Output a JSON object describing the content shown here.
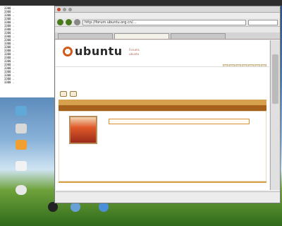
{
  "desktop": {
    "topbar": {
      "title": "",
      "clock": ""
    },
    "terminal_lines": [
      "  3300 .  ",
      "  3300 .  ",
      "  3300 .  ",
      "  3300 .  ",
      "  3300 .  ",
      "  3300 .  ",
      "  3300 .  ",
      "  3300 .  ",
      "  3300 .  ",
      "  3300 .  ",
      "  3300 .  ",
      "  3300 .  ",
      "  3300 .  ",
      "  3300 .  ",
      "  3300 .  ",
      "  3300 .  ",
      "  3300 .  ",
      "  3300 .  ",
      "  3300 .  ",
      "  3300 .  ",
      "  3300 .  ",
      "  3300 .  "
    ],
    "dock": [
      "",
      "",
      ""
    ]
  },
  "browser": {
    "menu": [
      "",
      "",
      "",
      "",
      "",
      "",
      "",
      ""
    ],
    "url": "http://forum.ubuntu.org.cn/...",
    "bookmarks": [
      "",
      "",
      "",
      ""
    ],
    "tabs": [
      "",
      "",
      ""
    ],
    "status": ""
  },
  "page": {
    "logo": "ubuntu",
    "subtitle": [
      "Forums",
      "ubuntu"
    ],
    "nav_tabs": [
      "",
      "",
      "",
      "",
      "",
      "",
      ""
    ],
    "crumb_left": [
      "",
      "",
      ""
    ],
    "crumb_right": [
      "",
      "",
      ""
    ],
    "thread_title": "",
    "reply_button": "",
    "new_button": "",
    "bar_title": "",
    "bar2_left": "",
    "bar2_right": "",
    "post": {
      "author": "",
      "quote": "",
      "text": "",
      "meta": [
        "",
        "",
        ""
      ],
      "foot_left": "",
      "foot_right": ""
    }
  }
}
